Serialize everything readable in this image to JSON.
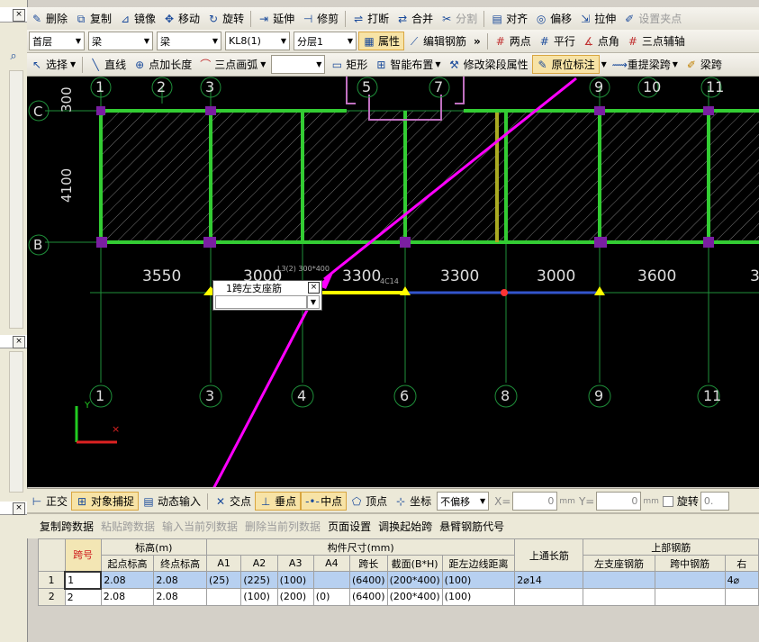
{
  "toolbar1": {
    "items": [
      {
        "label": "删除",
        "icon": "✎"
      },
      {
        "label": "复制",
        "icon": "⧉"
      },
      {
        "label": "镜像",
        "icon": "⊿"
      },
      {
        "label": "移动",
        "icon": "✥"
      },
      {
        "label": "旋转",
        "icon": "↻"
      },
      {
        "label": "延伸",
        "icon": "⇥"
      },
      {
        "label": "修剪",
        "icon": "⊣"
      },
      {
        "label": "打断",
        "icon": "⇌"
      },
      {
        "label": "合并",
        "icon": "⇄"
      },
      {
        "label": "分割",
        "icon": "✂"
      },
      {
        "label": "对齐",
        "icon": "▤"
      },
      {
        "label": "偏移",
        "icon": "◎"
      },
      {
        "label": "拉伸",
        "icon": "⇲"
      },
      {
        "label": "设置夹点",
        "icon": "✐"
      }
    ]
  },
  "toolbar2": {
    "floor": "首层",
    "category": "梁",
    "type": "梁",
    "element": "KL8(1)",
    "layer": "分层1",
    "properties": "属性",
    "edit_rebar": "编辑钢筋",
    "tools": [
      "两点",
      "平行",
      "点角",
      "三点辅轴"
    ]
  },
  "toolbar3": {
    "select": "选择",
    "line": "直线",
    "point_length": "点加长度",
    "arc": "三点画弧",
    "rect": "矩形",
    "smart": "智能布置",
    "modify_span": "修改梁段属性",
    "inplace": "原位标注",
    "relift": "重提梁跨",
    "span": "梁跨"
  },
  "canvas": {
    "top_axes": [
      "1",
      "2",
      "3",
      "5",
      "7",
      "9",
      "10",
      "11"
    ],
    "bottom_axes": [
      "1",
      "3",
      "4",
      "6",
      "8",
      "9",
      "11"
    ],
    "row_axes": [
      "C",
      "B"
    ],
    "dims_left": [
      "300",
      "4100"
    ],
    "dims_spans": [
      "3550",
      "3000",
      "3300",
      "3300",
      "3000",
      "3600",
      "3"
    ],
    "small_labels": [
      "L3(2) 300*400",
      "4C14"
    ],
    "popup_title": "1跨左支座筋",
    "popup_close": "×",
    "popup_value": ""
  },
  "statusbar": {
    "items": [
      "正交",
      "对象捕捉",
      "动态输入",
      "交点",
      "垂点",
      "中点",
      "顶点",
      "坐标"
    ],
    "offset": "不偏移",
    "x_label": "X=",
    "x_value": "0",
    "y_label": "Y=",
    "y_value": "0",
    "unit": "mm",
    "rotate": "旋转",
    "rotate_value": "0."
  },
  "grid_toolbar": {
    "items": [
      {
        "label": "复制跨数据",
        "dim": false
      },
      {
        "label": "粘贴跨数据",
        "dim": true
      },
      {
        "label": "输入当前列数据",
        "dim": true
      },
      {
        "label": "删除当前列数据",
        "dim": true
      },
      {
        "label": "页面设置",
        "dim": false
      },
      {
        "label": "调换起始跨",
        "dim": false
      },
      {
        "label": "悬臂钢筋代号",
        "dim": false
      }
    ]
  },
  "table": {
    "h_span": "跨号",
    "h_elev": "标高(m)",
    "h_size": "构件尺寸(mm)",
    "h_top_through": "上通长筋",
    "h_top_rebar": "上部钢筋",
    "h_start": "起点标高",
    "h_end": "终点标高",
    "h_a1": "A1",
    "h_a2": "A2",
    "h_a3": "A3",
    "h_a4": "A4",
    "h_span_len": "跨长",
    "h_section": "截面(B*H)",
    "h_dist": "距左边线距离",
    "h_left": "左支座钢筋",
    "h_mid": "跨中钢筋",
    "h_right": "右",
    "rows": [
      {
        "idx": "1",
        "span": "1",
        "start": "2.08",
        "end": "2.08",
        "a1": "(25)",
        "a2": "(225)",
        "a3": "(100)",
        "a4": "",
        "len": "(6400)",
        "sec": "(200*400)",
        "dist": "(100)",
        "through": "2⌀14",
        "left": "",
        "mid": "",
        "right": "4⌀"
      },
      {
        "idx": "2",
        "span": "2",
        "start": "2.08",
        "end": "2.08",
        "a1": "",
        "a2": "(100)",
        "a3": "(200)",
        "a4": "(0)",
        "len": "(6400)",
        "sec": "(200*400)",
        "dist": "(100)",
        "through": "",
        "left": "",
        "mid": "",
        "right": ""
      }
    ]
  },
  "colors": {
    "accent": "#ff00ff",
    "beam": "#33cc33",
    "column": "#7a1fa2",
    "axis": "#1f8f3a",
    "highlight": "#ffff00"
  }
}
